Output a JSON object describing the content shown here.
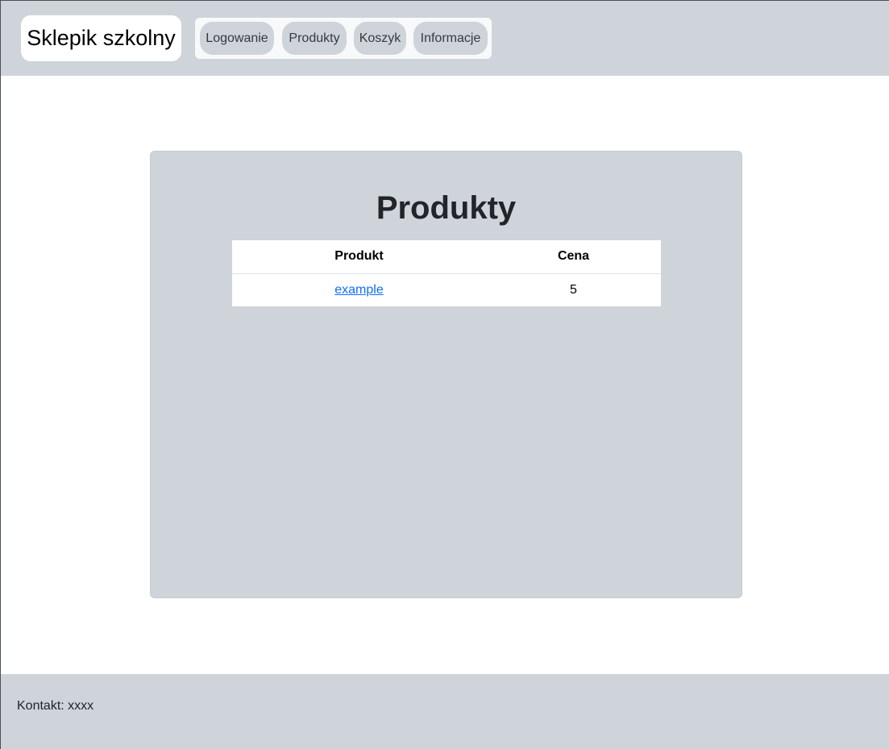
{
  "header": {
    "brand": "Sklepik szkolny",
    "nav": [
      {
        "label": "Logowanie"
      },
      {
        "label": "Produkty"
      },
      {
        "label": "Koszyk"
      },
      {
        "label": "Informacje"
      }
    ]
  },
  "main": {
    "title": "Produkty",
    "table": {
      "headers": [
        "Produkt",
        "Cena"
      ],
      "rows": [
        {
          "product": "example",
          "price": "5"
        }
      ]
    }
  },
  "footer": {
    "contact": "Kontakt: xxxx"
  },
  "colors": {
    "header_bg": "#ced4da",
    "card_bg": "#ced4da",
    "link": "#0d6efd"
  }
}
